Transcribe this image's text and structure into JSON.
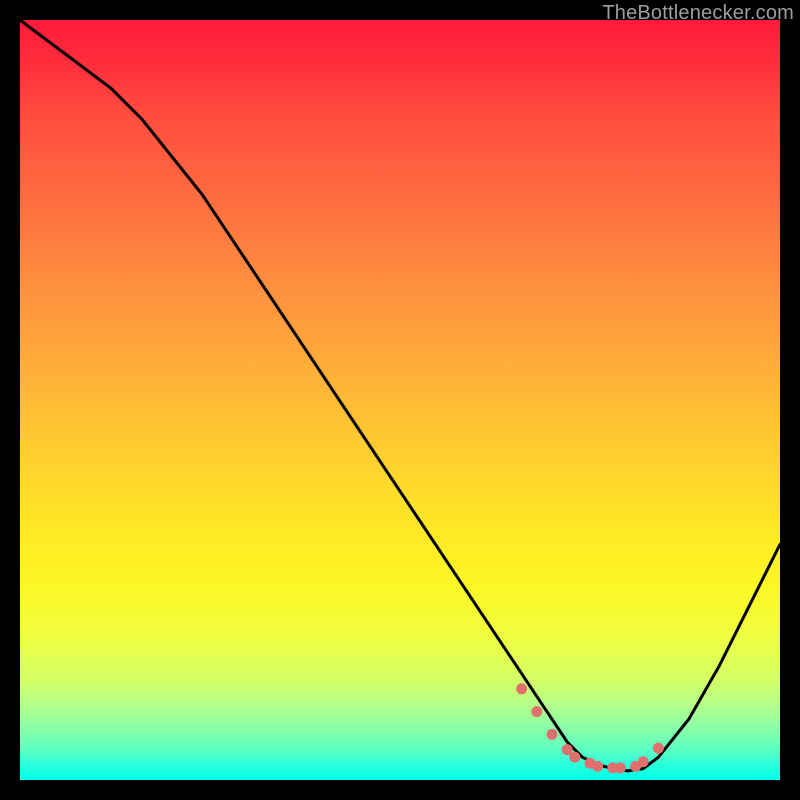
{
  "watermark": "TheBottlenecker.com",
  "chart_data": {
    "type": "line",
    "title": "",
    "xlabel": "",
    "ylabel": "",
    "xlim": [
      0,
      100
    ],
    "ylim": [
      0,
      100
    ],
    "series": [
      {
        "name": "bottleneck-curve",
        "x": [
          0,
          4,
          8,
          12,
          16,
          20,
          24,
          28,
          32,
          36,
          40,
          44,
          48,
          52,
          56,
          60,
          64,
          66,
          68,
          70,
          72,
          74,
          76,
          78,
          80,
          82,
          84,
          88,
          92,
          96,
          100
        ],
        "values": [
          100,
          97,
          94,
          91,
          87,
          82,
          77,
          71,
          65,
          59,
          53,
          47,
          41,
          35,
          29,
          23,
          17,
          14,
          11,
          8,
          5,
          3,
          2,
          1.5,
          1.2,
          1.5,
          3,
          8,
          15,
          23,
          31
        ]
      }
    ],
    "markers": {
      "name": "optimal-range-dots",
      "x": [
        66,
        68,
        70,
        72,
        73,
        75,
        76,
        78,
        79,
        81,
        82,
        84
      ],
      "values": [
        12,
        9,
        6,
        4,
        3,
        2.2,
        1.8,
        1.6,
        1.6,
        1.8,
        2.4,
        4.2
      ],
      "color": "#e07070",
      "radius": 5.5
    },
    "gradient_stops": [
      {
        "pos": 0.0,
        "color": "#ff1a3a"
      },
      {
        "pos": 0.5,
        "color": "#ffc034"
      },
      {
        "pos": 0.8,
        "color": "#f4fc34"
      },
      {
        "pos": 1.0,
        "color": "#00ffe8"
      }
    ]
  }
}
